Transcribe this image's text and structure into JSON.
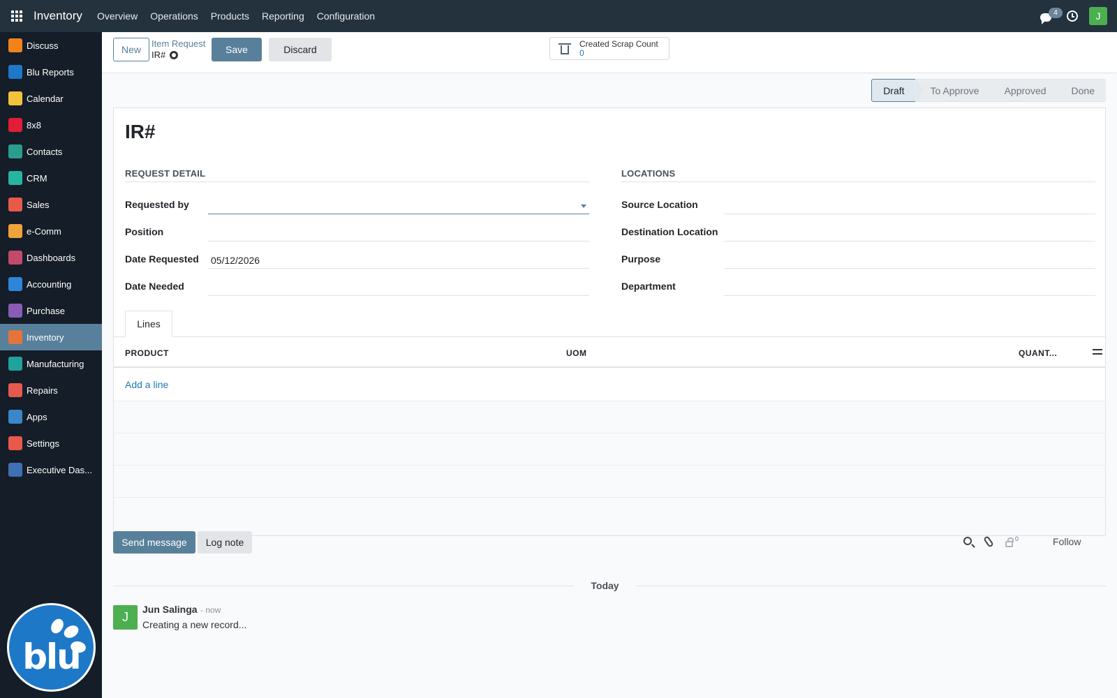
{
  "topbar": {
    "brand": "Inventory",
    "menu": [
      "Overview",
      "Operations",
      "Products",
      "Reporting",
      "Configuration"
    ],
    "chat_badge": "4",
    "user_initial": "J"
  },
  "sidebar": {
    "items": [
      {
        "label": "Discuss",
        "icon": "discuss-icon",
        "color": "#f2831a"
      },
      {
        "label": "Blu Reports",
        "icon": "blu-reports-icon",
        "color": "#1e78c8"
      },
      {
        "label": "Calendar",
        "icon": "calendar-icon",
        "color": "#f3c33c"
      },
      {
        "label": "8x8",
        "icon": "8x8-icon",
        "color": "#e21d38"
      },
      {
        "label": "Contacts",
        "icon": "contacts-icon",
        "color": "#2a9d8f"
      },
      {
        "label": "CRM",
        "icon": "crm-icon",
        "color": "#26b5a0"
      },
      {
        "label": "Sales",
        "icon": "sales-icon",
        "color": "#e8594a"
      },
      {
        "label": "e-Comm",
        "icon": "ecomm-icon",
        "color": "#f0a23b"
      },
      {
        "label": "Dashboards",
        "icon": "dashboards-icon",
        "color": "#c34a6b"
      },
      {
        "label": "Accounting",
        "icon": "accounting-icon",
        "color": "#2d86d8"
      },
      {
        "label": "Purchase",
        "icon": "purchase-icon",
        "color": "#8a5bb5"
      },
      {
        "label": "Inventory",
        "icon": "inventory-icon",
        "color": "#e5733c"
      },
      {
        "label": "Manufacturing",
        "icon": "manufacturing-icon",
        "color": "#1fa39a"
      },
      {
        "label": "Repairs",
        "icon": "repairs-icon",
        "color": "#e55a4d"
      },
      {
        "label": "Apps",
        "icon": "apps-icon",
        "color": "#3a86c8"
      },
      {
        "label": "Settings",
        "icon": "settings-icon",
        "color": "#e8594a"
      },
      {
        "label": "Executive Das...",
        "icon": "executive-dashboard-icon",
        "color": "#3f6fb5"
      }
    ],
    "active_index": 11,
    "logo_text": "blu"
  },
  "control": {
    "new_label": "New",
    "breadcrumb_parent": "Item Request",
    "breadcrumb_current": "IR#",
    "save_label": "Save",
    "discard_label": "Discard",
    "scrap_label": "Created Scrap Count",
    "scrap_value": "0"
  },
  "statusbar": {
    "stages": [
      "Draft",
      "To Approve",
      "Approved",
      "Done"
    ],
    "active": "Draft"
  },
  "form": {
    "title": "IR#",
    "request_detail_title": "REQUEST DETAIL",
    "locations_title": "LOCATIONS",
    "requested_by_label": "Requested by",
    "requested_by_value": "",
    "position_label": "Position",
    "date_requested_label": "Date Requested",
    "date_requested_value": "05/12/2026",
    "date_needed_label": "Date Needed",
    "source_location_label": "Source Location",
    "destination_location_label": "Destination Location",
    "purpose_label": "Purpose",
    "department_label": "Department",
    "tab_lines": "Lines",
    "col_product": "PRODUCT",
    "col_uom": "UOM",
    "col_quantity": "QUANT...",
    "add_line": "Add a line"
  },
  "chatter": {
    "send_message": "Send message",
    "log_note": "Log note",
    "follower_count": "0",
    "follow": "Follow",
    "today": "Today",
    "message": {
      "initial": "J",
      "author": "Jun Salinga",
      "time": "- now",
      "body": "Creating a new record..."
    }
  }
}
